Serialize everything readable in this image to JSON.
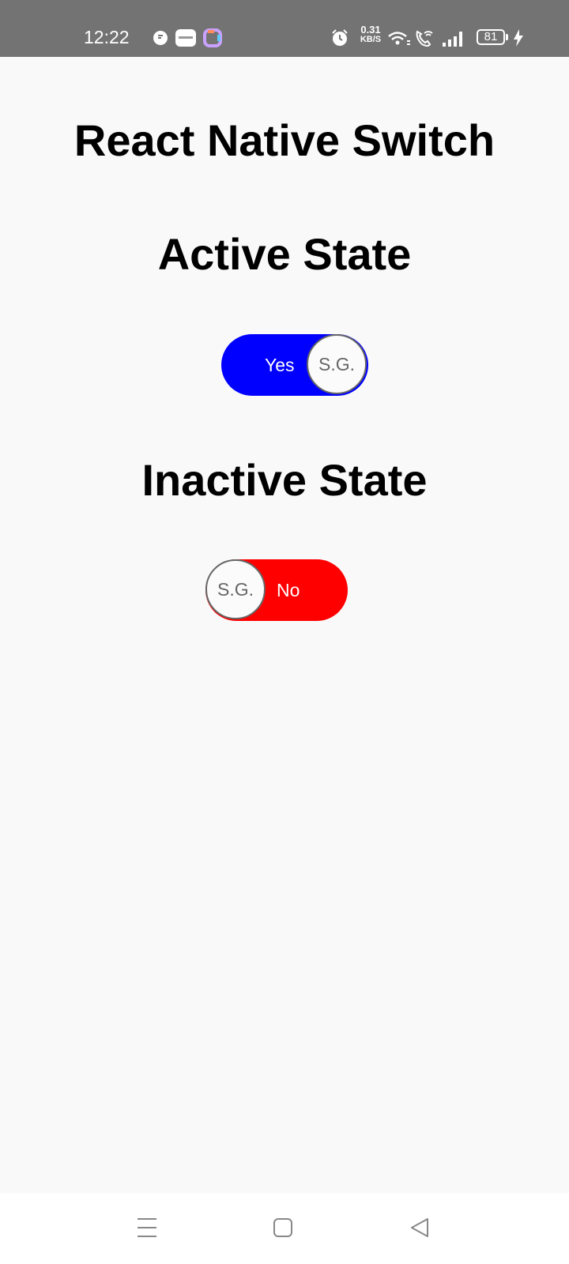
{
  "status_bar": {
    "time": "12:22",
    "net_speed_value": "0.31",
    "net_speed_unit": "KB/S",
    "battery": "81",
    "icons": [
      "chat-notification-icon",
      "app-badge-icon",
      "app-icon",
      "alarm-icon",
      "wifi-icon",
      "wifi-call-icon",
      "signal-icon",
      "battery-icon",
      "charging-icon"
    ]
  },
  "main": {
    "title": "React Native Switch",
    "active": {
      "heading": "Active State",
      "label": "Yes",
      "knob_text": "S.G.",
      "color": "#0000ff"
    },
    "inactive": {
      "heading": "Inactive State",
      "label": "No",
      "knob_text": "S.G.",
      "color": "#ff0000"
    }
  },
  "nav_bar": {
    "buttons": [
      "menu-icon",
      "home-icon",
      "back-icon"
    ]
  }
}
